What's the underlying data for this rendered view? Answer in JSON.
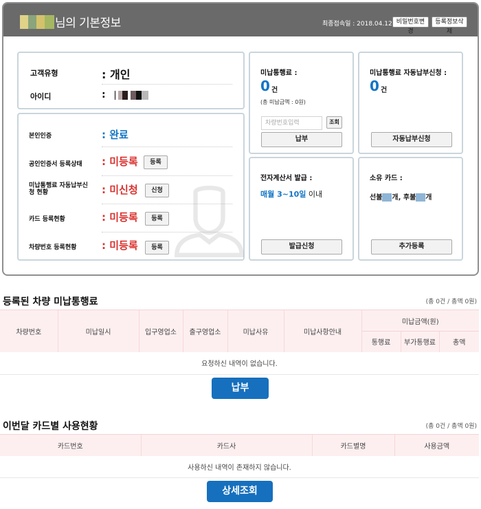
{
  "header": {
    "title": "님의 기본정보",
    "last_login": "최종접속일 : 2018.04.12",
    "change_pw": "비밀번호변경",
    "delete_reg": "등록정보삭제"
  },
  "basic": {
    "customer_type_label": "고객유형",
    "customer_type_value": ": 개인",
    "id_label": "아이디",
    "id_value": ":"
  },
  "auth": {
    "identity_label": "본인인증",
    "identity_value": ": 완료",
    "cert_label": "공인인증서 등록상태",
    "cert_value": ": 미등록",
    "unpaid_label": "미납통행료 자동납부신청 현황",
    "unpaid_value": ": 미신청",
    "card_label": "카드 등록현황",
    "card_value": ": 미등록",
    "car_label": "차량번호 등록현황",
    "car_value": ": 미등록",
    "reg_btn": "등록",
    "apply_btn": "신청"
  },
  "toll": {
    "title": "미납통행료 :",
    "count": "0",
    "unit": "건",
    "sub": "(총 미납금액 : 0원)",
    "input_placeholder": "차량번호입력",
    "search_btn": "조회",
    "pay_btn": "납부"
  },
  "auto": {
    "title": "미납통행료 자동납부신청 :",
    "count": "0",
    "unit": "건",
    "btn": "자동납부신청"
  },
  "invoice": {
    "title": "전자계산서 발급 :",
    "period": "매월 3~10일",
    "suffix": " 이내",
    "btn": "발급신청"
  },
  "cards": {
    "title": "소유 카드 :",
    "credit": "선불",
    "credit_unit": "개,",
    "debit": "후불",
    "debit_unit": "개",
    "btn": "추가등록"
  },
  "vehicle_section": {
    "title": "등록된 차량 미납통행료",
    "summary": "(총 0건 / 총액 0원)",
    "headers": [
      "차량번호",
      "미납일시",
      "입구영업소",
      "출구영업소",
      "미납사유",
      "미납사항안내",
      "미납금액(원)",
      "통행료",
      "부가통행료",
      "총액"
    ],
    "empty": "요청하신 내역이 없습니다.",
    "btn": "납부"
  },
  "card_section": {
    "title": "이번달 카드별 사용현황",
    "summary": "(총 0건 / 총액 0원)",
    "headers": [
      "카드번호",
      "카드사",
      "카드별명",
      "사용금액"
    ],
    "empty": "사용하신 내역이 존재하지 않습니다.",
    "btn": "상세조회"
  }
}
